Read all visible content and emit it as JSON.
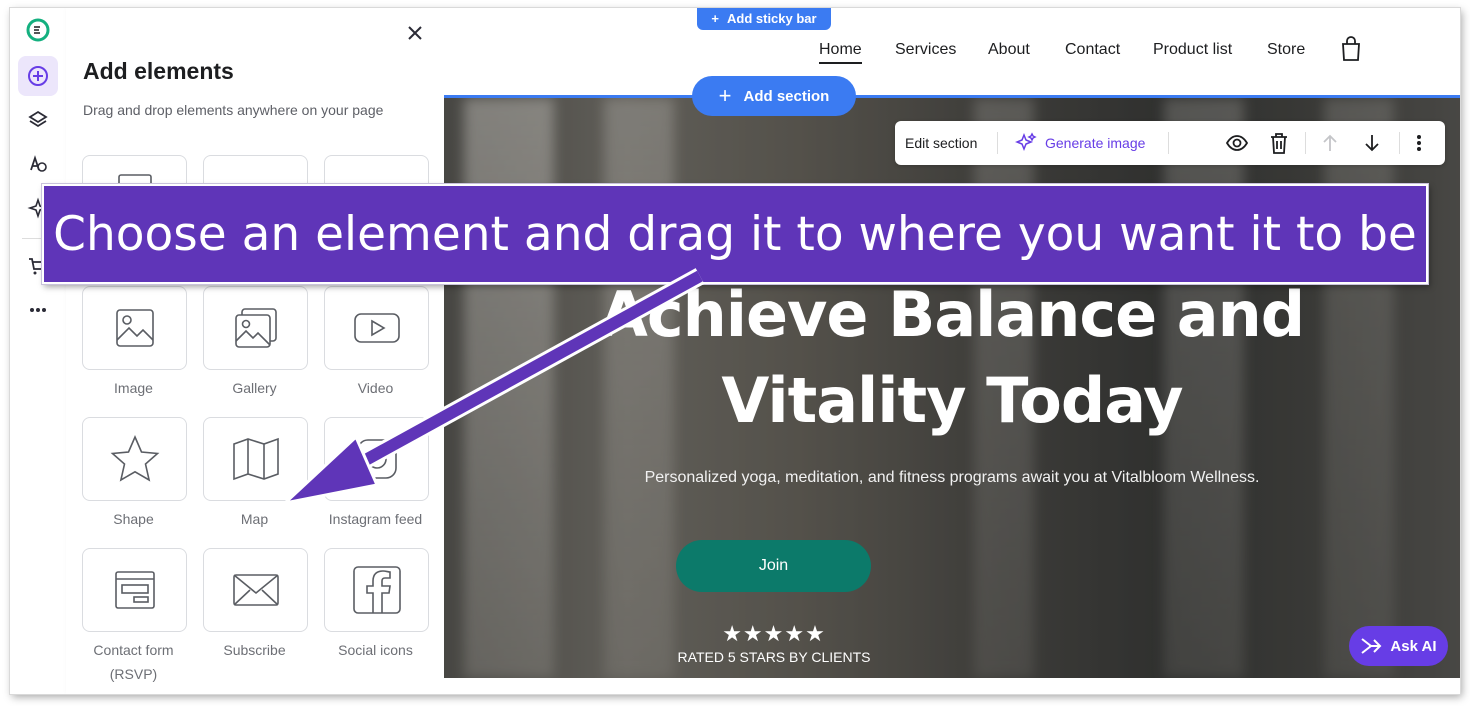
{
  "editor": {
    "panel": {
      "title": "Add elements",
      "subtitle": "Drag and drop elements anywhere on your page",
      "elements": [
        {
          "label": "Image",
          "icon": "image-icon"
        },
        {
          "label": "Gallery",
          "icon": "gallery-icon"
        },
        {
          "label": "Video",
          "icon": "video-icon"
        },
        {
          "label": "Shape",
          "icon": "star-shape-icon"
        },
        {
          "label": "Map",
          "icon": "map-icon"
        },
        {
          "label": "Instagram feed",
          "icon": "instagram-icon"
        },
        {
          "label": "Contact form (RSVP)",
          "icon": "contact-form-icon"
        },
        {
          "label": "Subscribe",
          "icon": "envelope-icon"
        },
        {
          "label": "Social icons",
          "icon": "facebook-icon"
        }
      ]
    },
    "add_sticky_bar": "Add sticky bar",
    "add_section": "Add section",
    "section_toolbar": {
      "edit_section": "Edit section",
      "generate_image": "Generate image"
    },
    "ask_ai": "Ask AI",
    "accent": "#673de6",
    "blue": "#3b7bf2"
  },
  "site": {
    "nav": [
      "Home",
      "Services",
      "About",
      "Contact",
      "Product list",
      "Store"
    ],
    "hero": {
      "title_line1": "Achieve Balance and",
      "title_line2": "Vitality Today",
      "paragraph": "Personalized yoga, meditation, and fitness programs await you at Vitalbloom Wellness.",
      "cta": "Join",
      "stars": "★★★★★",
      "rating_text": "RATED 5 STARS BY CLIENTS"
    }
  },
  "overlay": {
    "instruction": "Choose an element and drag it to where you want it to be",
    "color": "#5f35b8"
  }
}
